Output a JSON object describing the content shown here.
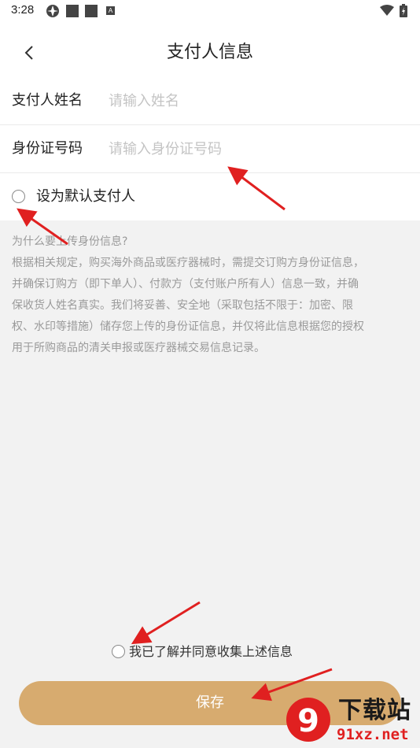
{
  "status_bar": {
    "time": "3:28",
    "icons": [
      "app-icon",
      "square-icon",
      "square-icon",
      "a-icon",
      "wifi-icon",
      "battery-icon"
    ],
    "a_glyph": "A"
  },
  "header": {
    "title": "支付人信息",
    "back_icon": "chevron-left-icon"
  },
  "form": {
    "name": {
      "label": "支付人姓名",
      "value": "",
      "placeholder": "请输入姓名"
    },
    "id": {
      "label": "身份证号码",
      "value": "",
      "placeholder": "请输入身份证号码"
    },
    "default": {
      "label": "设为默认支付人",
      "checked": false
    }
  },
  "info": {
    "question": "为什么要上传身份信息?",
    "lines": [
      "根据相关规定，购买海外商品或医疗器械时，需提交订购方身份证信息，",
      "并确保订购方（即下单人）、付款方（支付账户所有人）信息一致，并确",
      "保收货人姓名真实。我们将妥善、安全地（采取包括不限于：加密、限",
      "权、水印等措施）储存您上传的身份证信息，并仅将此信息根据您的授权",
      "用于所购商品的清关申报或医疗器械交易信息记录。"
    ]
  },
  "agreement": {
    "label": "我已了解并同意收集上述信息",
    "checked": false
  },
  "save_button": {
    "label": "保存"
  },
  "colors": {
    "accent": "#d7ab6f",
    "annotation_arrow": "#e02020",
    "page_bg": "#f2f2f2"
  },
  "watermark": {
    "logo_text": "下载站",
    "url": "91xz.net",
    "badge": "9"
  }
}
